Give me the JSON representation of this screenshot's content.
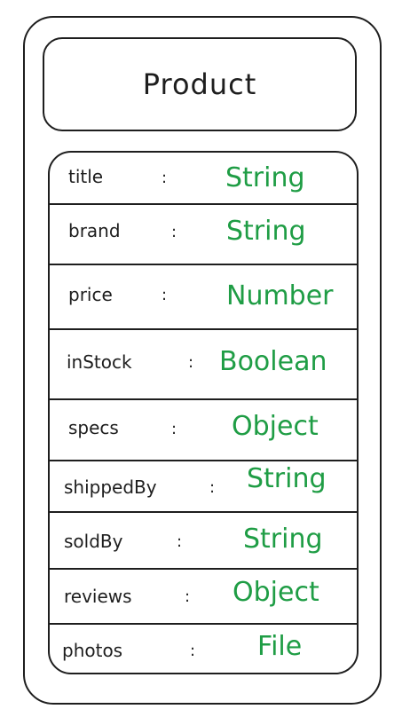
{
  "entity": {
    "title": "Product"
  },
  "fields": [
    {
      "name": "title",
      "type": "String"
    },
    {
      "name": "brand",
      "type": "String"
    },
    {
      "name": "price",
      "type": "Number"
    },
    {
      "name": "inStock",
      "type": "Boolean"
    },
    {
      "name": "specs",
      "type": "Object"
    },
    {
      "name": "shippedBy",
      "type": "String"
    },
    {
      "name": "soldBy",
      "type": "String"
    },
    {
      "name": "reviews",
      "type": "Object"
    },
    {
      "name": "photos",
      "type": "File"
    }
  ],
  "separator": ":",
  "colors": {
    "stroke": "#1e1e1e",
    "type": "#1f9d45"
  }
}
